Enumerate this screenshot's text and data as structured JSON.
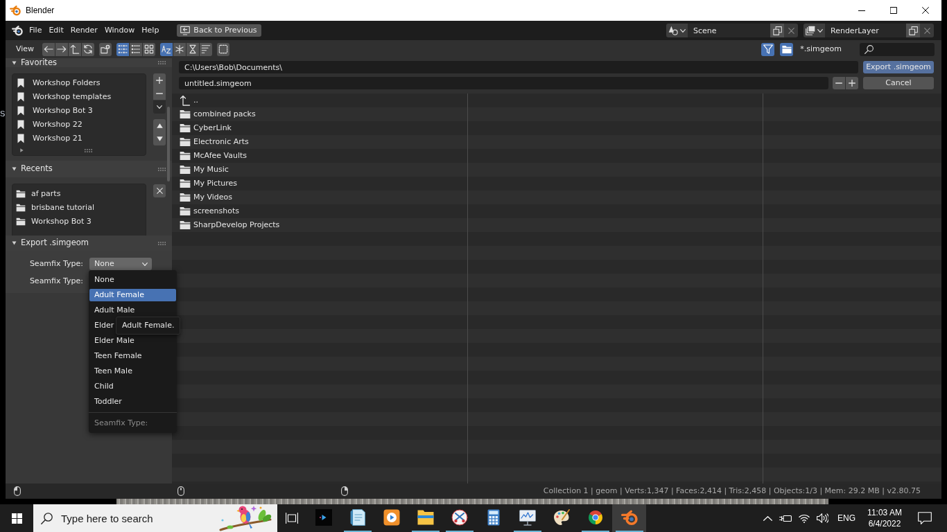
{
  "desktop": {
    "edge_text": "S"
  },
  "window": {
    "title": "Blender"
  },
  "menu_bar": {
    "items": [
      "File",
      "Edit",
      "Render",
      "Window",
      "Help"
    ],
    "back_button": "Back to Previous",
    "scene": "Scene",
    "view_layer": "RenderLayer"
  },
  "header": {
    "view_menu": "View",
    "display_modes": [
      {
        "kind": "columns",
        "selected": true
      },
      {
        "kind": "rows",
        "selected": false
      },
      {
        "kind": "thumbnails",
        "selected": false
      }
    ],
    "sort_modes": [
      {
        "kind": "name",
        "selected": true
      },
      {
        "kind": "extension",
        "selected": false
      },
      {
        "kind": "time",
        "selected": false
      },
      {
        "kind": "size",
        "selected": false
      }
    ],
    "show_hidden": false,
    "filter_enabled": true,
    "folder_filter": true,
    "filter_glob": "*.simgeom"
  },
  "path": "C:\\Users\\Bob\\Documents\\",
  "filename": "untitled.simgeom",
  "actions": {
    "export": "Export .simgeom",
    "cancel": "Cancel"
  },
  "favorites": {
    "title": "Favorites",
    "expanded": true,
    "items": [
      "Workshop Folders",
      "Workshop templates",
      "Workshop Bot 3",
      "Workshop 22",
      "Workshop 21"
    ]
  },
  "recents": {
    "title": "Recents",
    "expanded": true,
    "items": [
      "af parts",
      "brisbane tutorial",
      "Workshop Bot 3"
    ]
  },
  "export_panel": {
    "title": "Export .simgeom",
    "expanded": true,
    "rows": [
      {
        "label": "Seamfix Type:",
        "value": "None",
        "open": true
      },
      {
        "label": "Seamfix Type:"
      }
    ]
  },
  "dropdown_menu": {
    "items": [
      {
        "label": "None",
        "selected": false
      },
      {
        "label": "Adult Female",
        "selected": true
      },
      {
        "label": "Adult Male",
        "selected": false
      },
      {
        "label": "Elder",
        "selected": false
      },
      {
        "label": "Elder Male",
        "selected": false
      },
      {
        "label": "Teen Female",
        "selected": false
      },
      {
        "label": "Teen Male",
        "selected": false
      },
      {
        "label": "Child",
        "selected": false
      },
      {
        "label": "Toddler",
        "selected": false
      }
    ],
    "title": "Seamfix Type:"
  },
  "tooltip": {
    "text": "Adult Female."
  },
  "files": [
    {
      "kind": "parent",
      "name": ".."
    },
    {
      "kind": "folder",
      "name": "combined packs"
    },
    {
      "kind": "folder",
      "name": "CyberLink"
    },
    {
      "kind": "folder",
      "name": "Electronic Arts"
    },
    {
      "kind": "folder",
      "name": "McAfee Vaults"
    },
    {
      "kind": "folder",
      "name": "My Music"
    },
    {
      "kind": "folder",
      "name": "My Pictures"
    },
    {
      "kind": "folder",
      "name": "My Videos"
    },
    {
      "kind": "folder",
      "name": "screenshots"
    },
    {
      "kind": "folder",
      "name": "SharpDevelop Projects"
    }
  ],
  "status_bar": {
    "text": "Collection 1 | geom | Verts:1,347 | Faces:2,414 | Tris:2,458 | Objects:1/3 | Mem: 29.2 MB | v2.80.75"
  },
  "taskbar": {
    "search_placeholder": "Type here to search",
    "apps": [
      {
        "kind": "play-tile",
        "running": false,
        "selected": false
      },
      {
        "kind": "notepad",
        "running": true,
        "selected": false
      },
      {
        "kind": "play-button",
        "running": false,
        "selected": false
      },
      {
        "kind": "folder",
        "running": true,
        "selected": false
      },
      {
        "kind": "scissors",
        "running": true,
        "selected": false
      },
      {
        "kind": "calculator",
        "running": false,
        "selected": false
      },
      {
        "kind": "monitor-chart",
        "running": true,
        "selected": false
      },
      {
        "kind": "palette",
        "running": false,
        "selected": false
      },
      {
        "kind": "round-logo",
        "running": true,
        "selected": false
      },
      {
        "kind": "app-logo",
        "running": true,
        "selected": true
      }
    ],
    "language": "ENG",
    "time": "11:03 AM",
    "date": "6/4/2022"
  }
}
